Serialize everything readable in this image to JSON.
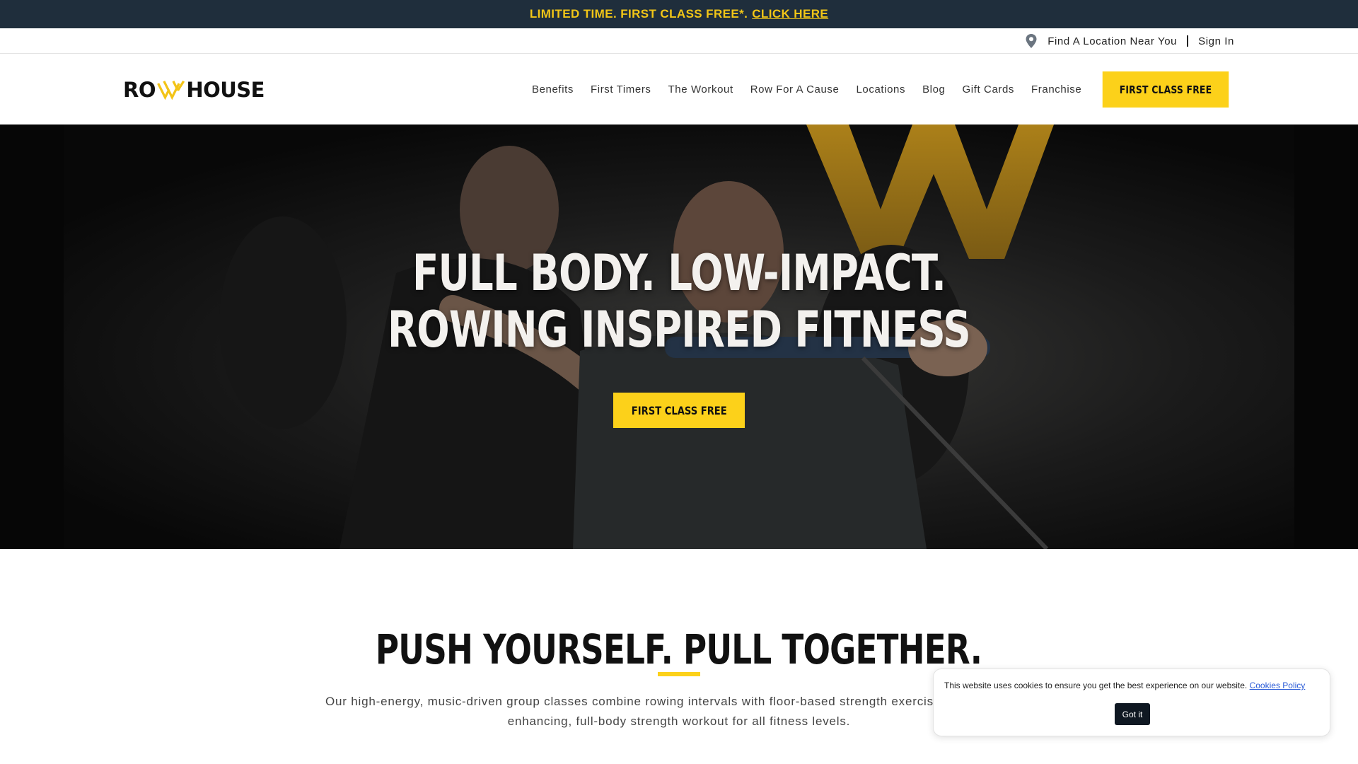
{
  "promo": {
    "text": "LIMITED TIME. FIRST CLASS FREE*.",
    "link": "CLICK HERE"
  },
  "utility": {
    "location_icon": "map-pin-icon",
    "find_location": "Find A Location Near You",
    "sign_in": "Sign In"
  },
  "header": {
    "logo_text_left": "RO",
    "logo_text_right": "HOUSE",
    "nav": [
      "Benefits",
      "First Timers",
      "The Workout",
      "Row For A Cause",
      "Locations",
      "Blog",
      "Gift Cards",
      "Franchise"
    ],
    "cta": "FIRST CLASS FREE"
  },
  "hero": {
    "title_line1": "FULL BODY. LOW-IMPACT.",
    "title_line2": "ROWING INSPIRED FITNESS",
    "cta": "FIRST CLASS FREE"
  },
  "section": {
    "title": "PUSH YOURSELF. PULL TOGETHER.",
    "body_line1": "Our high-energy, music-driven group classes combine rowing intervals with floor-based strength exercises for the ultimat",
    "body_line2": "enhancing, full-body strength workout for all fitness levels."
  },
  "cookie": {
    "text": "This website uses cookies to ensure you get the best experience on our website.",
    "link": "Cookies Policy",
    "button": "Got it"
  },
  "colors": {
    "accent": "#fcd11a",
    "promo_bg": "#1f2e3c",
    "promo_text": "#f2c617"
  }
}
